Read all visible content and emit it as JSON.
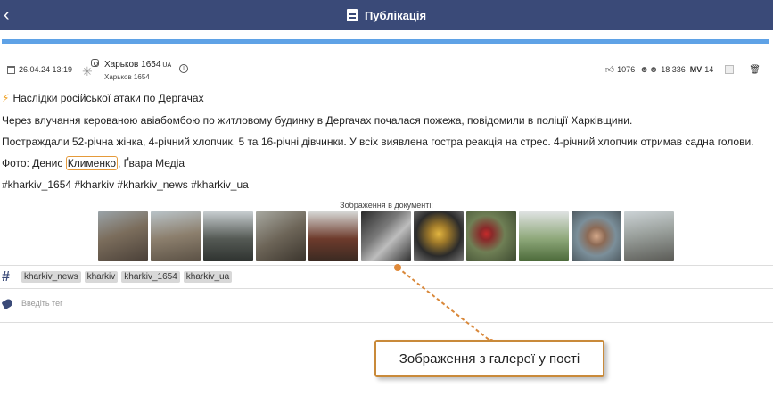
{
  "header": {
    "title": "Публікація"
  },
  "meta": {
    "date": "26.04.24 13:19",
    "source_name": "Харьков 1654",
    "source_lang": "UA",
    "source_sub": "Харьков 1654",
    "likes": "1076",
    "audience": "18 336",
    "mv": "MV",
    "mv_value": "14"
  },
  "post": {
    "headline": "Наслідки російської атаки по Дергачах",
    "p1": "Через влучання керованою авіабомбою по житловому будинку в Дергачах почалася пожежа, повідомили в поліції Харківщини.",
    "p2": "Постраждали 52-річна жінка, 4-річний хлопчик, 5 та 16-річні дівчинки. У всіх виявлена гостра реакція на стрес. 4-річний хлопчик отримав садна голови.",
    "p4_prefix": "Фото: Денис ",
    "p4_highlight": "Клименко",
    "p4_suffix": ", Ґвара Медіа",
    "p5": "#kharkiv_1654 #kharkiv #kharkiv_news #kharkiv_ua"
  },
  "gallery": {
    "label": "Зображення в документі:",
    "count": 11
  },
  "tags": [
    "kharkiv_news",
    "kharkiv",
    "kharkiv_1654",
    "kharkiv_ua"
  ],
  "tag_input": {
    "placeholder": "Введіть тег"
  },
  "callout": {
    "text": "Зображення з галереї у пості"
  },
  "colors": {
    "header": "#3a4a78",
    "progress": "#5fa2e6",
    "callout_border": "#c98a3a"
  }
}
